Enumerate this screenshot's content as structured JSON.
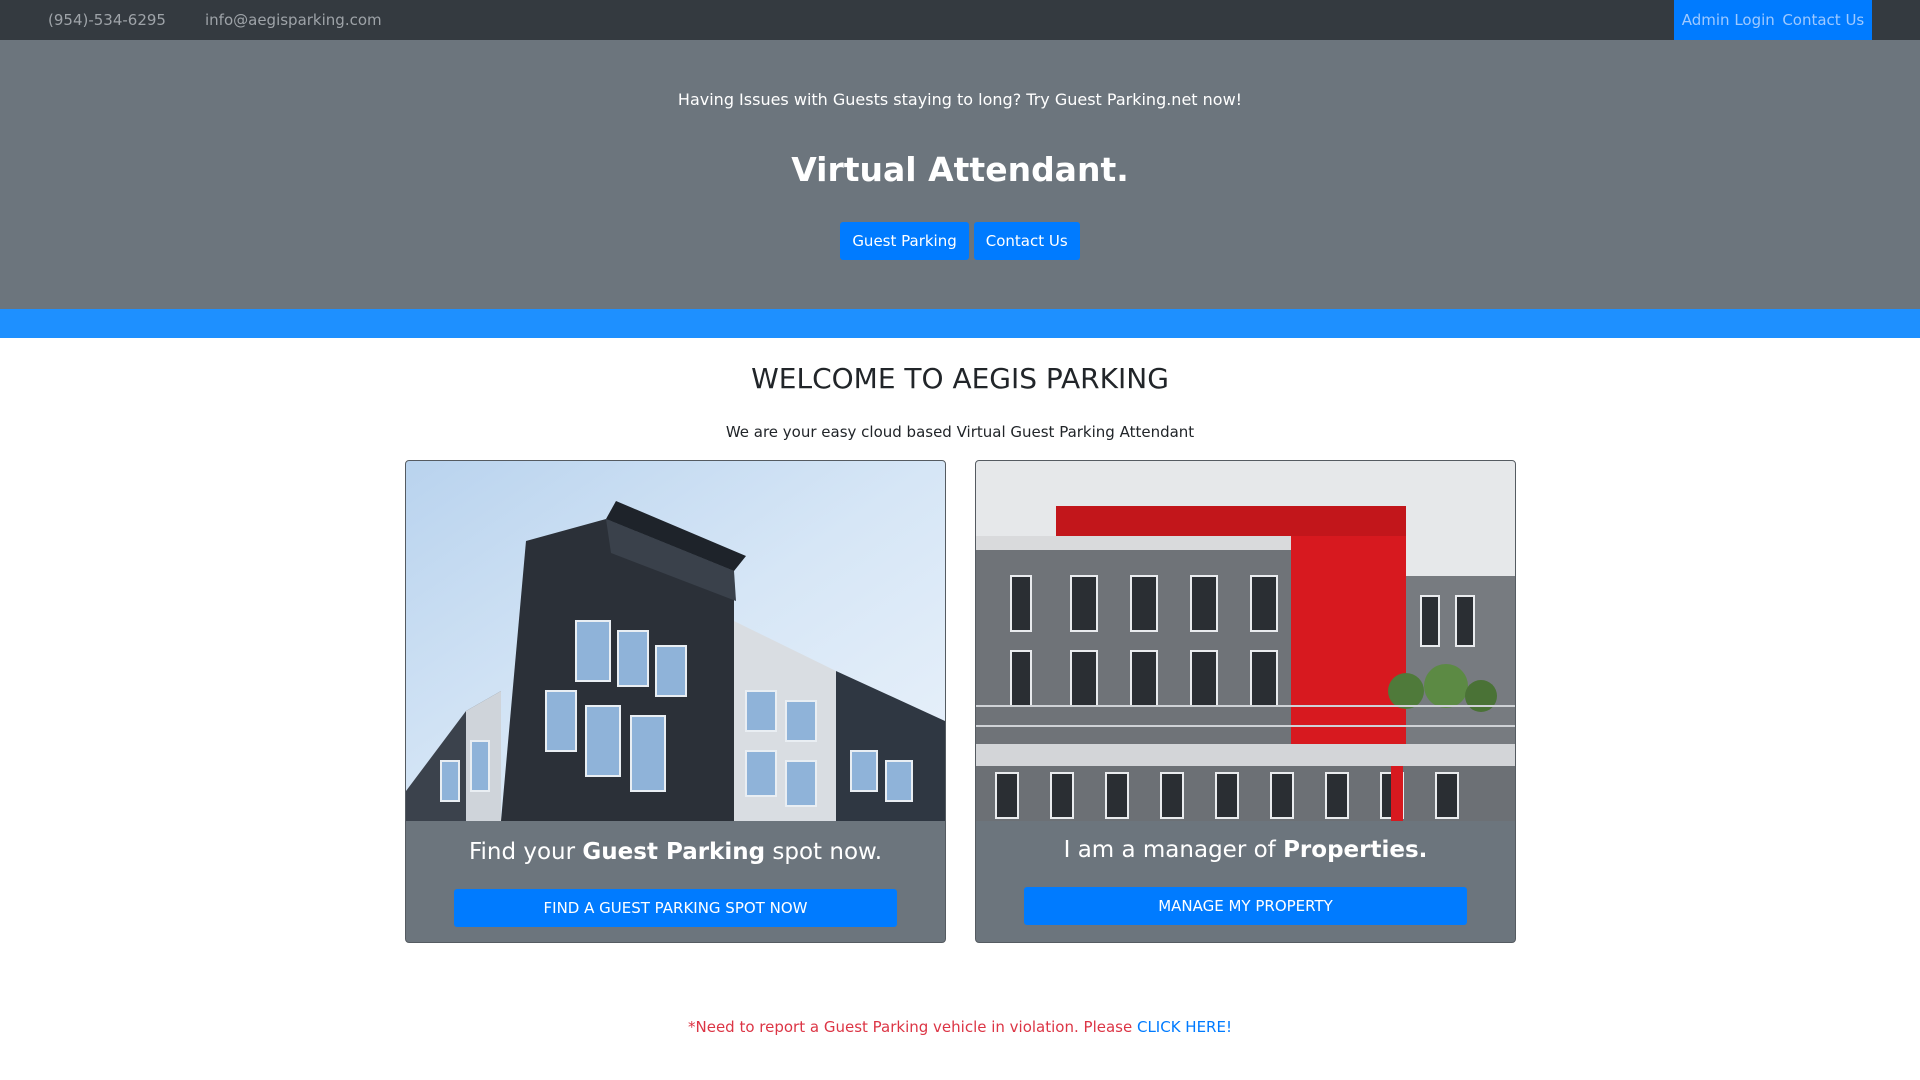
{
  "topbar": {
    "phone": "(954)-534-6295",
    "email": "info@aegisparking.com",
    "admin_login": "Admin Login",
    "contact_us": "Contact Us"
  },
  "hero": {
    "tagline": "Having Issues with Guests staying to long? Try Guest Parking.net now!",
    "headline": "Virtual Attendant.",
    "guest_parking_button": "Guest Parking",
    "contact_us_button": "Contact Us"
  },
  "welcome": {
    "title": "WELCOME TO AEGIS PARKING",
    "subtitle": "We are your easy cloud based Virtual Guest Parking Attendant"
  },
  "cards": {
    "guest": {
      "caption_pre": "Find your ",
      "caption_bold": "Guest Parking",
      "caption_post": " spot now.",
      "button": "FIND A GUEST PARKING SPOT NOW"
    },
    "manager": {
      "caption_pre": "I am a manager of ",
      "caption_bold": "Properties.",
      "button": "MANAGE MY PROPERTY"
    }
  },
  "report": {
    "text": "*Need to report a Guest Parking vehicle in violation. Please ",
    "link": "CLICK HERE!"
  }
}
